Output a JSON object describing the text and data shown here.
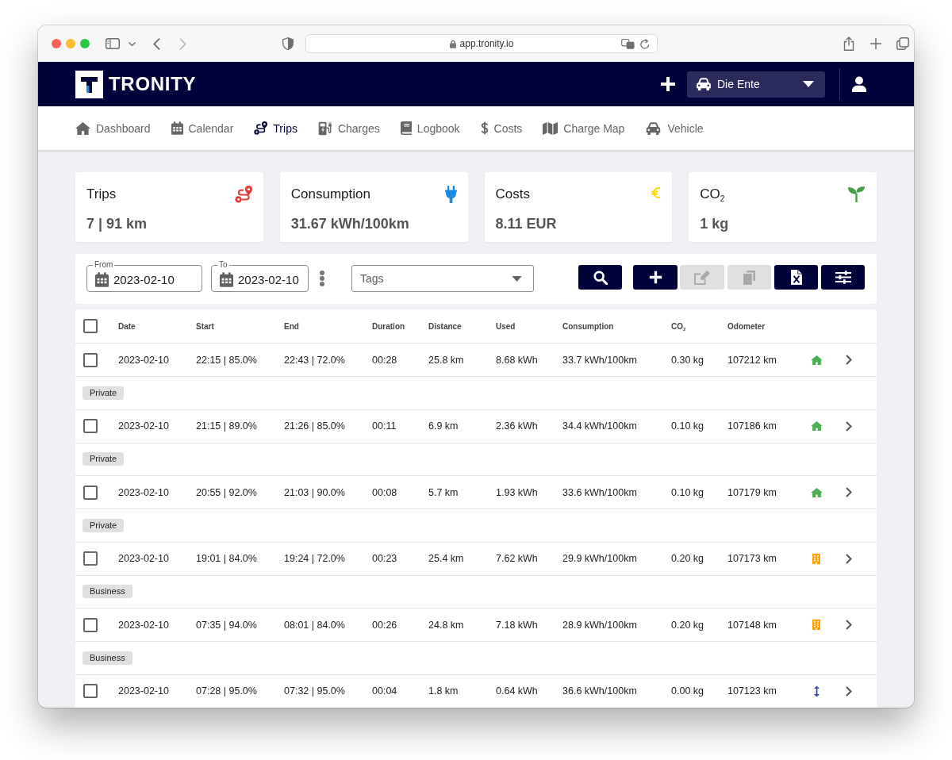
{
  "browser": {
    "url": "app.tronity.io"
  },
  "header": {
    "brand": "TRONITY",
    "vehicle": "Die Ente"
  },
  "nav": [
    {
      "label": "Dashboard",
      "selected": false
    },
    {
      "label": "Calendar",
      "selected": false
    },
    {
      "label": "Trips",
      "selected": true
    },
    {
      "label": "Charges",
      "selected": false
    },
    {
      "label": "Logbook",
      "selected": false
    },
    {
      "label": "Costs",
      "selected": false
    },
    {
      "label": "Charge Map",
      "selected": false
    },
    {
      "label": "Vehicle",
      "selected": false
    }
  ],
  "stats": [
    {
      "title": "Trips",
      "value": "7 | 91 km"
    },
    {
      "title": "Consumption",
      "value": "31.67 kWh/100km"
    },
    {
      "title": "Costs",
      "value": "8.11 EUR"
    },
    {
      "title": "CO$_{2}$",
      "value": "1 kg"
    }
  ],
  "filters": {
    "from": {
      "label": "From",
      "value": "2023-02-10"
    },
    "to": {
      "label": "To",
      "value": "2023-02-10"
    },
    "tags": {
      "placeholder": "Tags"
    },
    "buttons": [
      {
        "disabled": false
      },
      {
        "disabled": false
      },
      {
        "disabled": true
      },
      {
        "disabled": true
      },
      {
        "disabled": false
      },
      {
        "disabled": false
      }
    ]
  },
  "table": {
    "select_all_checked": false,
    "columns": [
      "Date",
      "Start",
      "End",
      "Duration",
      "Distance",
      "Used",
      "Consumption",
      "CO$_{2}$",
      "Odometer"
    ],
    "rows": [
      {
        "checked": false,
        "cells": [
          "2023-02-10",
          "22:15 | 85.0%",
          "22:43 | 72.0%",
          "00:28",
          "25.8 km",
          "8.68 kWh",
          "33.7 kWh/100km",
          "0.30 kg",
          "107212 km"
        ],
        "kind": "home",
        "tag": "Private"
      },
      {
        "checked": false,
        "cells": [
          "2023-02-10",
          "21:15 | 89.0%",
          "21:26 | 85.0%",
          "00:11",
          "6.9 km",
          "2.36 kWh",
          "34.4 kWh/100km",
          "0.10 kg",
          "107186 km"
        ],
        "kind": "home",
        "tag": "Private"
      },
      {
        "checked": false,
        "cells": [
          "2023-02-10",
          "20:55 | 92.0%",
          "21:03 | 90.0%",
          "00:08",
          "5.7 km",
          "1.93 kWh",
          "33.6 kWh/100km",
          "0.10 kg",
          "107179 km"
        ],
        "kind": "home",
        "tag": "Private"
      },
      {
        "checked": false,
        "cells": [
          "2023-02-10",
          "19:01 | 84.0%",
          "19:24 | 72.0%",
          "00:23",
          "25.4 km",
          "7.62 kWh",
          "29.9 kWh/100km",
          "0.20 kg",
          "107173 km"
        ],
        "kind": "business",
        "tag": "Business"
      },
      {
        "checked": false,
        "cells": [
          "2023-02-10",
          "07:35 | 94.0%",
          "08:01 | 84.0%",
          "00:26",
          "24.8 km",
          "7.18 kWh",
          "28.9 kWh/100km",
          "0.20 kg",
          "107148 km"
        ],
        "kind": "business",
        "tag": "Business"
      },
      {
        "checked": false,
        "cells": [
          "2023-02-10",
          "07:28 | 95.0%",
          "07:32 | 95.0%",
          "00:04",
          "1.8 km",
          "0.64 kWh",
          "36.6 kWh/100km",
          "0.00 kg",
          "107123 km"
        ],
        "kind": "other"
      }
    ]
  }
}
